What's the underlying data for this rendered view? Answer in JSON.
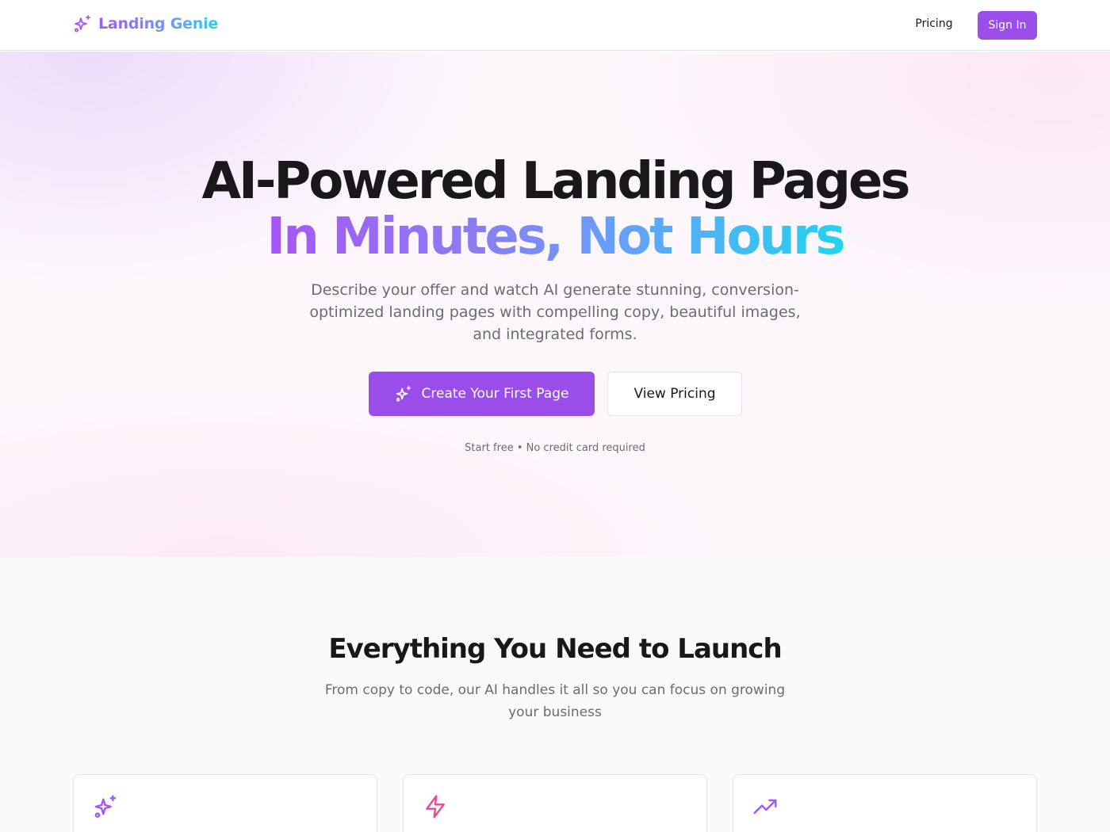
{
  "header": {
    "brand": "Landing Genie",
    "nav": {
      "pricing": "Pricing"
    },
    "sign_in": "Sign In"
  },
  "hero": {
    "title_line1": "AI-Powered Landing Pages",
    "title_line2": "In Minutes, Not Hours",
    "subtitle": "Describe your offer and watch AI generate stunning, conversion-optimized landing pages with compelling copy, beautiful images, and integrated forms.",
    "cta_primary": "Create Your First Page",
    "cta_secondary": "View Pricing",
    "note": "Start free • No credit card required"
  },
  "features": {
    "title": "Everything You Need to Launch",
    "subtitle": "From copy to code, our AI handles it all so you can focus on growing your business",
    "cards": [
      {
        "icon": "sparkles-icon",
        "color": "#a855f7"
      },
      {
        "icon": "lightning-icon",
        "color": "#ec4899"
      },
      {
        "icon": "trending-up-icon",
        "color": "#a855f7"
      }
    ]
  },
  "colors": {
    "accent": "#9b4dea",
    "gradient_start": "#a855f7",
    "gradient_end": "#22d3ee",
    "text": "#18181b",
    "muted": "#6b6b74"
  }
}
